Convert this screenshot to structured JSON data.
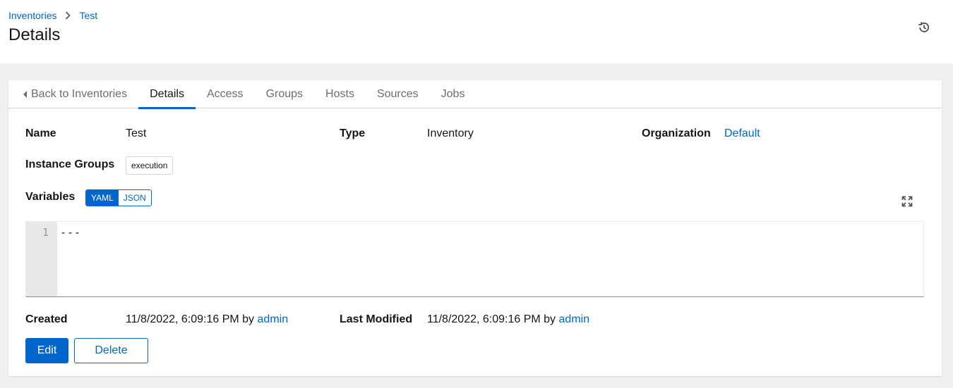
{
  "breadcrumb": {
    "parent": "Inventories",
    "current": "Test"
  },
  "page": {
    "title": "Details"
  },
  "icons": {
    "history": "history-icon",
    "expand": "expand-icon",
    "separator": "chevron-right-icon",
    "back": "caret-left-icon"
  },
  "tabs": [
    {
      "label": "Back to Inventories",
      "active": false
    },
    {
      "label": "Details",
      "active": true
    },
    {
      "label": "Access",
      "active": false
    },
    {
      "label": "Groups",
      "active": false
    },
    {
      "label": "Hosts",
      "active": false
    },
    {
      "label": "Sources",
      "active": false
    },
    {
      "label": "Jobs",
      "active": false
    }
  ],
  "details": {
    "name_label": "Name",
    "name_value": "Test",
    "type_label": "Type",
    "type_value": "Inventory",
    "org_label": "Organization",
    "org_value": "Default",
    "instance_groups_label": "Instance Groups",
    "instance_groups": [
      "execution"
    ],
    "variables_label": "Variables",
    "format_options": [
      "YAML",
      "JSON"
    ],
    "format_selected": "YAML",
    "editor": {
      "line_number": "1",
      "content": "---"
    },
    "created_label": "Created",
    "created_date": "11/8/2022, 6:09:16 PM by",
    "created_user": "admin",
    "modified_label": "Last Modified",
    "modified_date": "11/8/2022, 6:09:16 PM by",
    "modified_user": "admin"
  },
  "actions": {
    "edit": "Edit",
    "delete": "Delete"
  },
  "colors": {
    "accent": "#0066cc",
    "text": "#151515",
    "muted": "#6a6e73",
    "background": "#f0f0f0"
  }
}
